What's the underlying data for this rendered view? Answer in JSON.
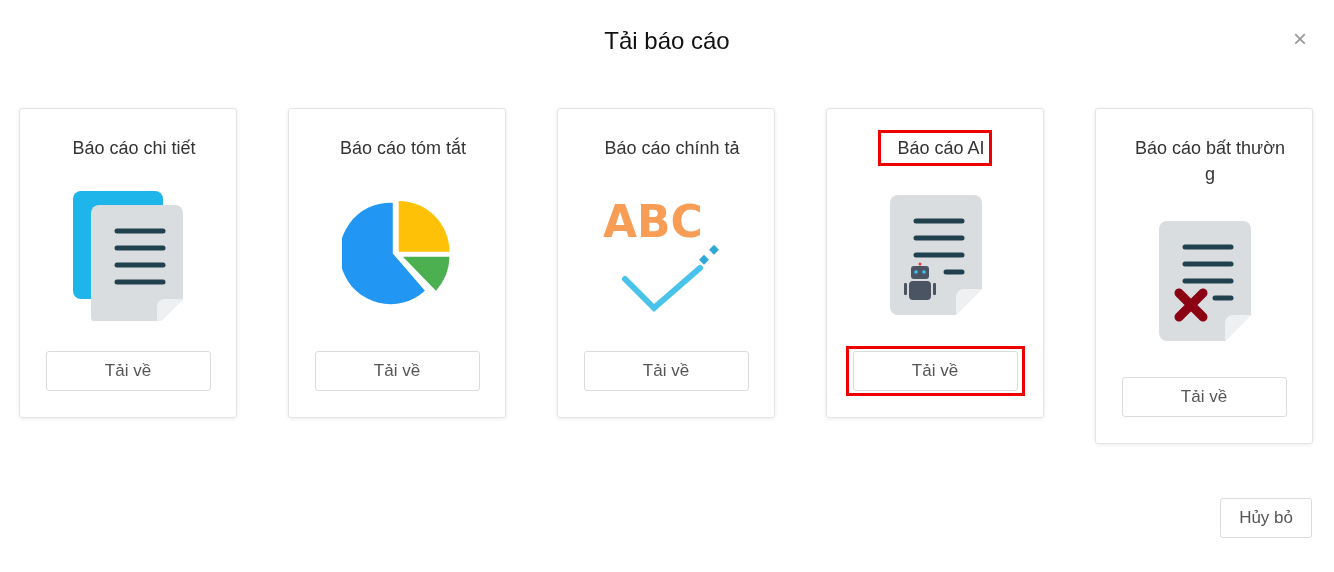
{
  "dialog": {
    "title": "Tải báo cáo",
    "close": "×"
  },
  "cards": [
    {
      "title": "Báo cáo chi tiết",
      "button": "Tải về",
      "title_highlighted": false,
      "button_highlighted": false
    },
    {
      "title": "Báo cáo tóm tắt",
      "button": "Tải về",
      "title_highlighted": false,
      "button_highlighted": false
    },
    {
      "title": "Báo cáo chính tả",
      "icon_text": "ABC",
      "button": "Tải về",
      "title_highlighted": false,
      "button_highlighted": false
    },
    {
      "title": "Báo cáo AI",
      "button": "Tải về",
      "title_highlighted": true,
      "button_highlighted": true
    },
    {
      "title": "Báo cáo bất thường",
      "button": "Tải về",
      "title_highlighted": false,
      "button_highlighted": false
    }
  ],
  "footer": {
    "cancel": "Hủy bỏ"
  }
}
